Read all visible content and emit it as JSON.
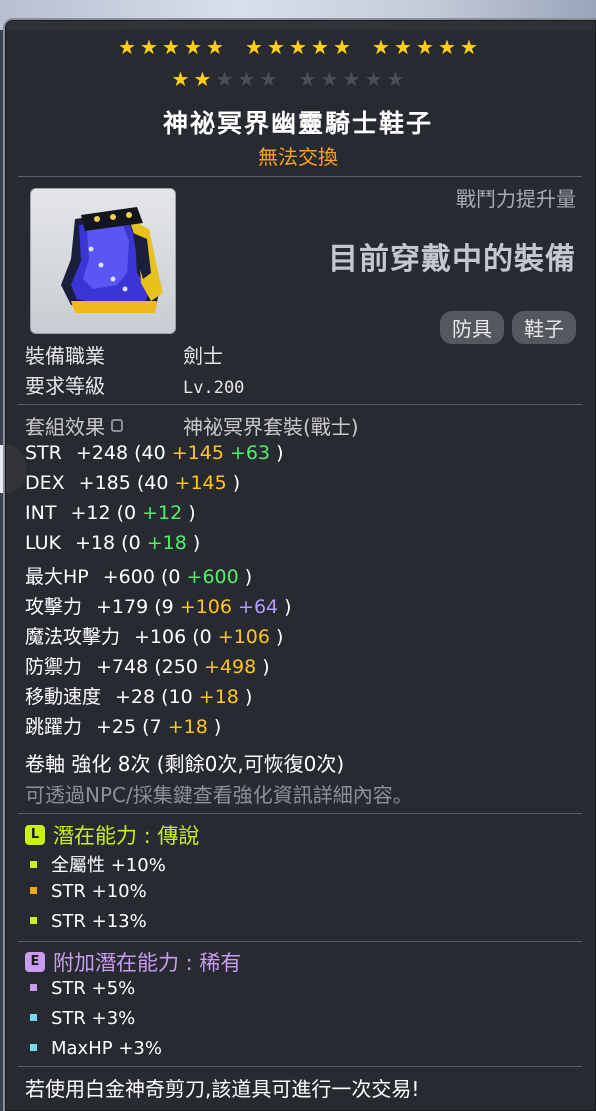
{
  "stars": {
    "total": 25,
    "filled": 17
  },
  "item": {
    "name": "神祕冥界幽靈騎士鞋子",
    "trade_status": "無法交換",
    "combat_power_label": "戰鬥力提升量",
    "equipped_label": "目前穿戴中的裝備",
    "tags": [
      "防具",
      "鞋子"
    ],
    "icon": "purple-boot-icon"
  },
  "requirements": {
    "job_label": "裝備職業",
    "job_value": "劍士",
    "level_label": "要求等級",
    "level_value": "Lv.200"
  },
  "set": {
    "label": "套組效果",
    "value": "神祕冥界套裝(戰士)"
  },
  "stats": [
    {
      "name": "STR",
      "total": "+248",
      "base": "(40",
      "parts": [
        {
          "text": "+145",
          "color": "yellow"
        },
        {
          "text": "+63",
          "color": "green"
        }
      ],
      "close": ")"
    },
    {
      "name": "DEX",
      "total": "+185",
      "base": "(40",
      "parts": [
        {
          "text": "+145",
          "color": "yellow"
        }
      ],
      "close": ")"
    },
    {
      "name": "INT",
      "total": "+12",
      "base": "(0",
      "parts": [
        {
          "text": "+12",
          "color": "green"
        }
      ],
      "close": ")"
    },
    {
      "name": "LUK",
      "total": "+18",
      "base": "(0",
      "parts": [
        {
          "text": "+18",
          "color": "green"
        }
      ],
      "close": ")"
    },
    {
      "name": "最大HP",
      "total": "+600",
      "base": "(0",
      "parts": [
        {
          "text": "+600",
          "color": "green"
        }
      ],
      "close": ")"
    },
    {
      "name": "攻擊力",
      "total": "+179",
      "base": "(9",
      "parts": [
        {
          "text": "+106",
          "color": "yellow"
        },
        {
          "text": "+64",
          "color": "purple"
        }
      ],
      "close": ")"
    },
    {
      "name": "魔法攻擊力",
      "total": "+106",
      "base": "(0",
      "parts": [
        {
          "text": "+106",
          "color": "yellow"
        }
      ],
      "close": ")"
    },
    {
      "name": "防禦力",
      "total": "+748",
      "base": "(250",
      "parts": [
        {
          "text": "+498",
          "color": "yellow"
        }
      ],
      "close": ")"
    },
    {
      "name": "移動速度",
      "total": "+28",
      "base": "(10",
      "parts": [
        {
          "text": "+18",
          "color": "yellow"
        }
      ],
      "close": ")"
    },
    {
      "name": "跳躍力",
      "total": "+25",
      "base": "(7",
      "parts": [
        {
          "text": "+18",
          "color": "yellow"
        }
      ],
      "close": ")"
    }
  ],
  "scroll": {
    "line": "卷軸 強化 8次 (剩餘0次,可恢復0次)",
    "hint": "可透過NPC/採集鍵查看強化資訊詳細內容。"
  },
  "potential": {
    "badge": "L",
    "label": "潛在能力 : 傳說",
    "color": "#c8f01a",
    "lines": [
      {
        "text": "全屬性 +10%",
        "bullet": "#c8f01a"
      },
      {
        "text": "STR +10%",
        "bullet": "#f0a81a"
      },
      {
        "text": "STR +13%",
        "bullet": "#c8f01a"
      }
    ]
  },
  "additional": {
    "badge": "E",
    "label": "附加潛在能力 : 稀有",
    "color": "#c89cf0",
    "lines": [
      {
        "text": "STR +5%",
        "bullet": "#c89cf0"
      },
      {
        "text": "STR +3%",
        "bullet": "#7ad8f0"
      },
      {
        "text": "MaxHP +3%",
        "bullet": "#7ad8f0"
      }
    ]
  },
  "footer": "若使用白金神奇剪刀,該道具可進行一次交易!"
}
